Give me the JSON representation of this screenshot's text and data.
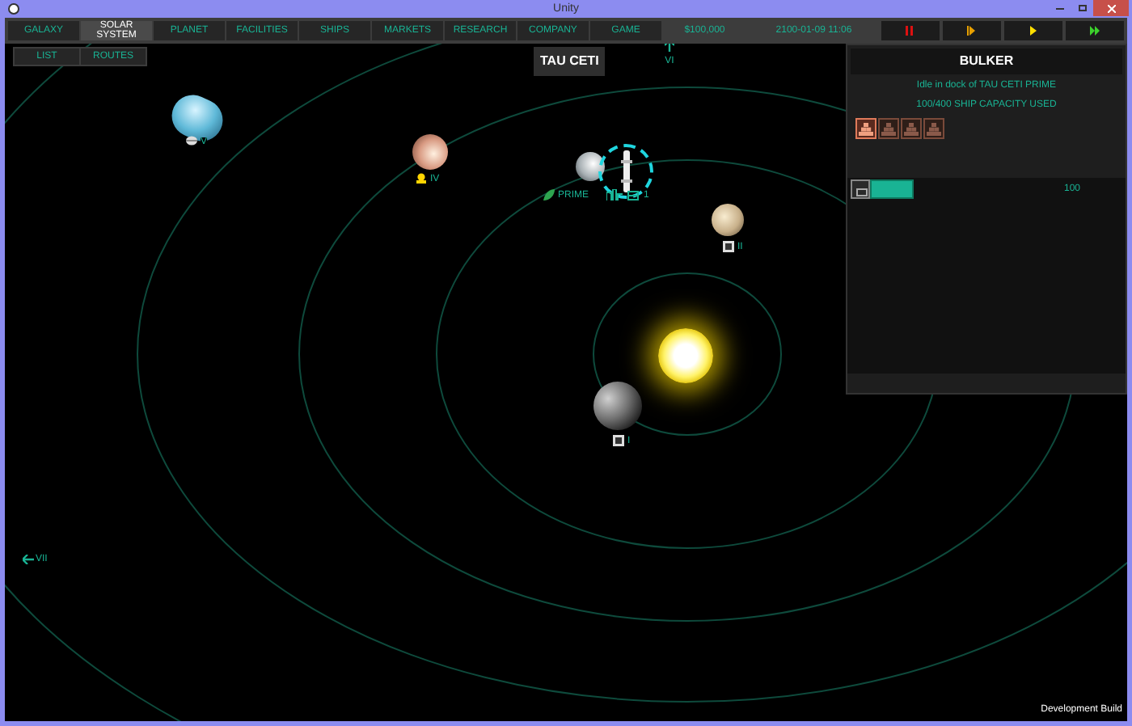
{
  "window": {
    "title": "Unity"
  },
  "menu": [
    {
      "label": "GALAXY",
      "selected": false
    },
    {
      "label": "SOLAR SYSTEM",
      "selected": true
    },
    {
      "label": "PLANET",
      "selected": false
    },
    {
      "label": "FACILITIES",
      "selected": false
    },
    {
      "label": "SHIPS",
      "selected": false
    },
    {
      "label": "MARKETS",
      "selected": false
    },
    {
      "label": "RESEARCH",
      "selected": false
    },
    {
      "label": "COMPANY",
      "selected": false
    },
    {
      "label": "GAME",
      "selected": false
    }
  ],
  "money": "$100,000",
  "date": "2100-01-09 11:06",
  "speed_controls": [
    {
      "kind": "pause"
    },
    {
      "kind": "slow"
    },
    {
      "kind": "play"
    },
    {
      "kind": "fast"
    }
  ],
  "view_buttons": [
    "LIST",
    "ROUTES"
  ],
  "system_name": "TAU CETI",
  "nav_arrows": [
    {
      "kind": "up",
      "label": "VI"
    },
    {
      "kind": "left",
      "label": "VII"
    }
  ],
  "bodies": [
    {
      "kind": "gas",
      "label": "V"
    },
    {
      "kind": "rocky",
      "label": "IV"
    },
    {
      "kind": "home",
      "label": "PRIME"
    },
    {
      "kind": "dwarf",
      "label": "II"
    },
    {
      "kind": "star"
    },
    {
      "kind": "moon",
      "label": "I"
    }
  ],
  "docked_ships": {
    "count": "1"
  },
  "ship_panel": {
    "title": "BULKER",
    "status": "Idle in dock of TAU CETI PRIME",
    "capacity": "100/400 SHIP CAPACITY USED",
    "cargo_slots": [
      {
        "filled": true
      },
      {
        "filled": false
      },
      {
        "filled": false
      },
      {
        "filled": false
      }
    ],
    "cargo": [
      {
        "amount": "100",
        "level": 0.25
      }
    ]
  },
  "footer": "Development Build"
}
